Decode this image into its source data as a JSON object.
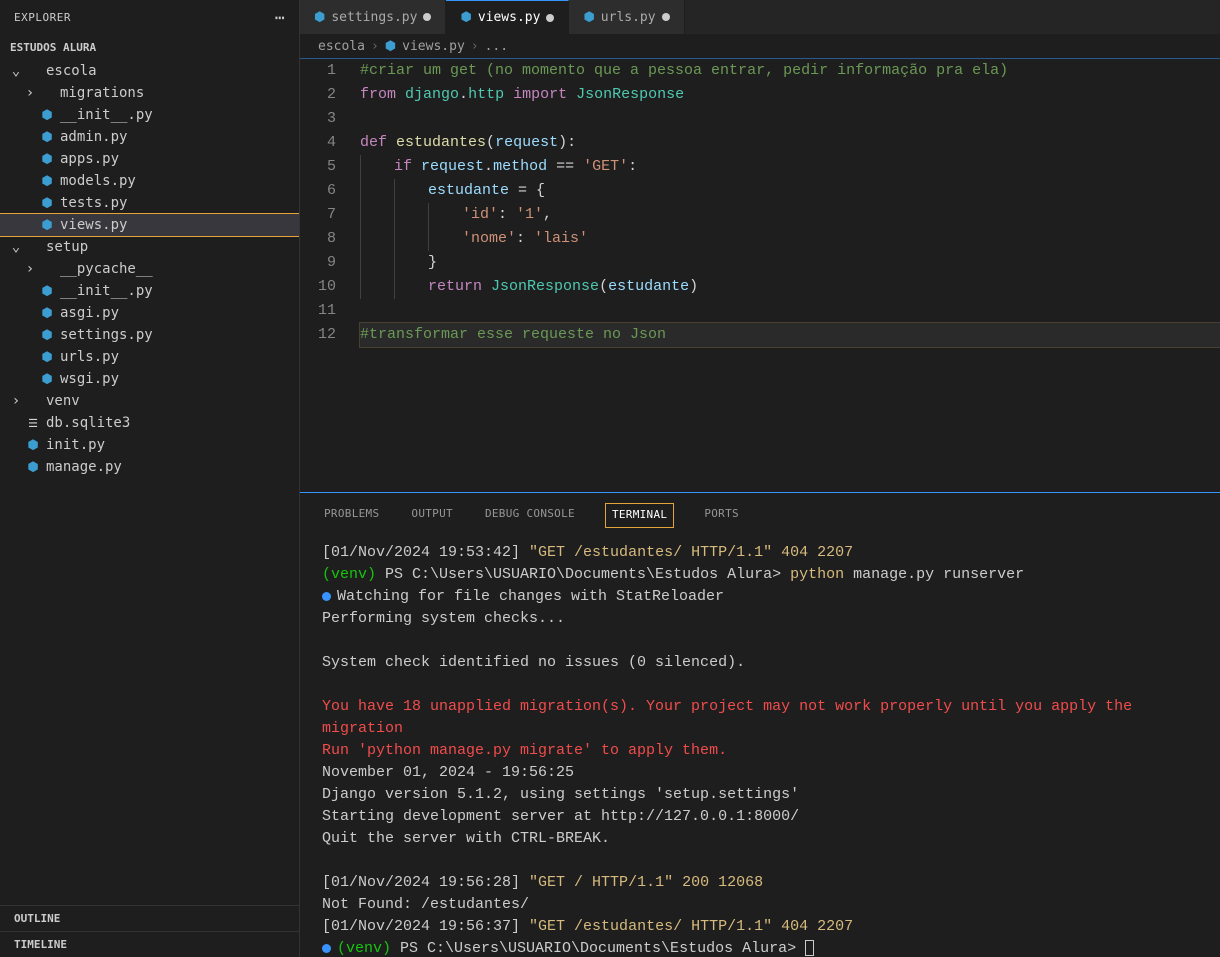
{
  "sidebar": {
    "title": "EXPLORER",
    "project": "ESTUDOS ALURA",
    "tree": [
      {
        "name": "escola",
        "type": "folder",
        "expanded": true,
        "indent": 0
      },
      {
        "name": "migrations",
        "type": "folder",
        "expanded": false,
        "indent": 1
      },
      {
        "name": "__init__.py",
        "type": "py",
        "indent": 1
      },
      {
        "name": "admin.py",
        "type": "py",
        "indent": 1
      },
      {
        "name": "apps.py",
        "type": "py",
        "indent": 1
      },
      {
        "name": "models.py",
        "type": "py",
        "indent": 1
      },
      {
        "name": "tests.py",
        "type": "py",
        "indent": 1
      },
      {
        "name": "views.py",
        "type": "py",
        "indent": 1,
        "selected": true
      },
      {
        "name": "setup",
        "type": "folder",
        "expanded": true,
        "indent": 0
      },
      {
        "name": "__pycache__",
        "type": "folder",
        "expanded": false,
        "indent": 1
      },
      {
        "name": "__init__.py",
        "type": "py",
        "indent": 1
      },
      {
        "name": "asgi.py",
        "type": "py",
        "indent": 1
      },
      {
        "name": "settings.py",
        "type": "py",
        "indent": 1
      },
      {
        "name": "urls.py",
        "type": "py",
        "indent": 1
      },
      {
        "name": "wsgi.py",
        "type": "py",
        "indent": 1
      },
      {
        "name": "venv",
        "type": "folder",
        "expanded": false,
        "indent": 0
      },
      {
        "name": "db.sqlite3",
        "type": "db",
        "indent": 0
      },
      {
        "name": "init.py",
        "type": "py",
        "indent": 0
      },
      {
        "name": "manage.py",
        "type": "py",
        "indent": 0
      }
    ],
    "sections": [
      "OUTLINE",
      "TIMELINE"
    ]
  },
  "tabs": [
    {
      "label": "settings.py",
      "dirty": true,
      "active": false
    },
    {
      "label": "views.py",
      "dirty": true,
      "active": true
    },
    {
      "label": "urls.py",
      "dirty": true,
      "active": false
    }
  ],
  "breadcrumb": [
    "escola",
    "views.py",
    "..."
  ],
  "code": {
    "lines": [
      {
        "n": 1,
        "html": "<span class='c-comment'>#criar um get (no momento que a pessoa entrar, pedir informação pra ela)</span>"
      },
      {
        "n": 2,
        "html": "<span class='c-kw'>from</span> <span class='c-module'>django</span>.<span class='c-module'>http</span> <span class='c-kw'>import</span> <span class='c-module'>JsonResponse</span>"
      },
      {
        "n": 3,
        "html": ""
      },
      {
        "n": 4,
        "html": "<span class='c-kw'>def</span> <span class='c-fnname'>estudantes</span>(<span class='c-var'>request</span>):"
      },
      {
        "n": 5,
        "html": "<span class='indent-guide'></span><span class='c-kw'>if</span> <span class='c-var'>request</span>.<span class='c-var'>method</span> == <span class='c-str'>'GET'</span>:"
      },
      {
        "n": 6,
        "html": "<span class='indent-guide'></span><span class='indent-guide'></span><span class='c-var'>estudante</span> = {"
      },
      {
        "n": 7,
        "html": "<span class='indent-guide'></span><span class='indent-guide'></span><span class='indent-guide'></span><span class='c-str'>'id'</span>: <span class='c-str'>'1'</span>,"
      },
      {
        "n": 8,
        "html": "<span class='indent-guide'></span><span class='indent-guide'></span><span class='indent-guide'></span><span class='c-str'>'nome'</span>: <span class='c-str'>'lais'</span>"
      },
      {
        "n": 9,
        "html": "<span class='indent-guide'></span><span class='indent-guide'></span>}"
      },
      {
        "n": 10,
        "html": "<span class='indent-guide'></span><span class='indent-guide'></span><span class='c-kw'>return</span> <span class='c-module'>JsonResponse</span>(<span class='c-var'>estudante</span>)"
      },
      {
        "n": 11,
        "html": ""
      },
      {
        "n": 12,
        "html": "<span class='c-comment'>#transformar esse requeste no Json</span>",
        "hl": true
      }
    ]
  },
  "panel": {
    "tabs": [
      "PROBLEMS",
      "OUTPUT",
      "DEBUG CONSOLE",
      "TERMINAL",
      "PORTS"
    ],
    "active": "TERMINAL",
    "terminal": [
      {
        "html": "[01/Nov/2024 19:53:42] <span class='t-yellow'>\"GET /estudantes/ HTTP/1.1\" 404 2207</span>"
      },
      {
        "html": "<span class='t-green'>(venv)</span> PS C:\\Users\\USUARIO\\Documents\\Estudos Alura> <span class='t-yellow'>python</span> manage.py runserver"
      },
      {
        "html": "<span class='t-blue-dot'></span>Watching for file changes with StatReloader"
      },
      {
        "html": "Performing system checks..."
      },
      {
        "html": ""
      },
      {
        "html": "System check identified no issues (0 silenced)."
      },
      {
        "html": ""
      },
      {
        "html": "<span class='t-red'>You have 18 unapplied migration(s). Your project may not work properly until you apply the migration</span>"
      },
      {
        "html": "<span class='t-red'>Run 'python manage.py migrate' to apply them.</span>"
      },
      {
        "html": "November 01, 2024 - 19:56:25"
      },
      {
        "html": "Django version 5.1.2, using settings 'setup.settings'"
      },
      {
        "html": "Starting development server at http://127.0.0.1:8000/"
      },
      {
        "html": "Quit the server with CTRL-BREAK."
      },
      {
        "html": ""
      },
      {
        "html": "[01/Nov/2024 19:56:28] <span class='t-yellow'>\"GET / HTTP/1.1\" 200 12068</span>"
      },
      {
        "html": "Not Found: /estudantes/"
      },
      {
        "html": "[01/Nov/2024 19:56:37] <span class='t-yellow'>\"GET /estudantes/ HTTP/1.1\" 404 2207</span>"
      },
      {
        "html": "<span class='t-blue-dot'></span><span class='t-green'>(venv)</span> PS C:\\Users\\USUARIO\\Documents\\Estudos Alura> <span class='cursor-box'></span>"
      }
    ]
  }
}
